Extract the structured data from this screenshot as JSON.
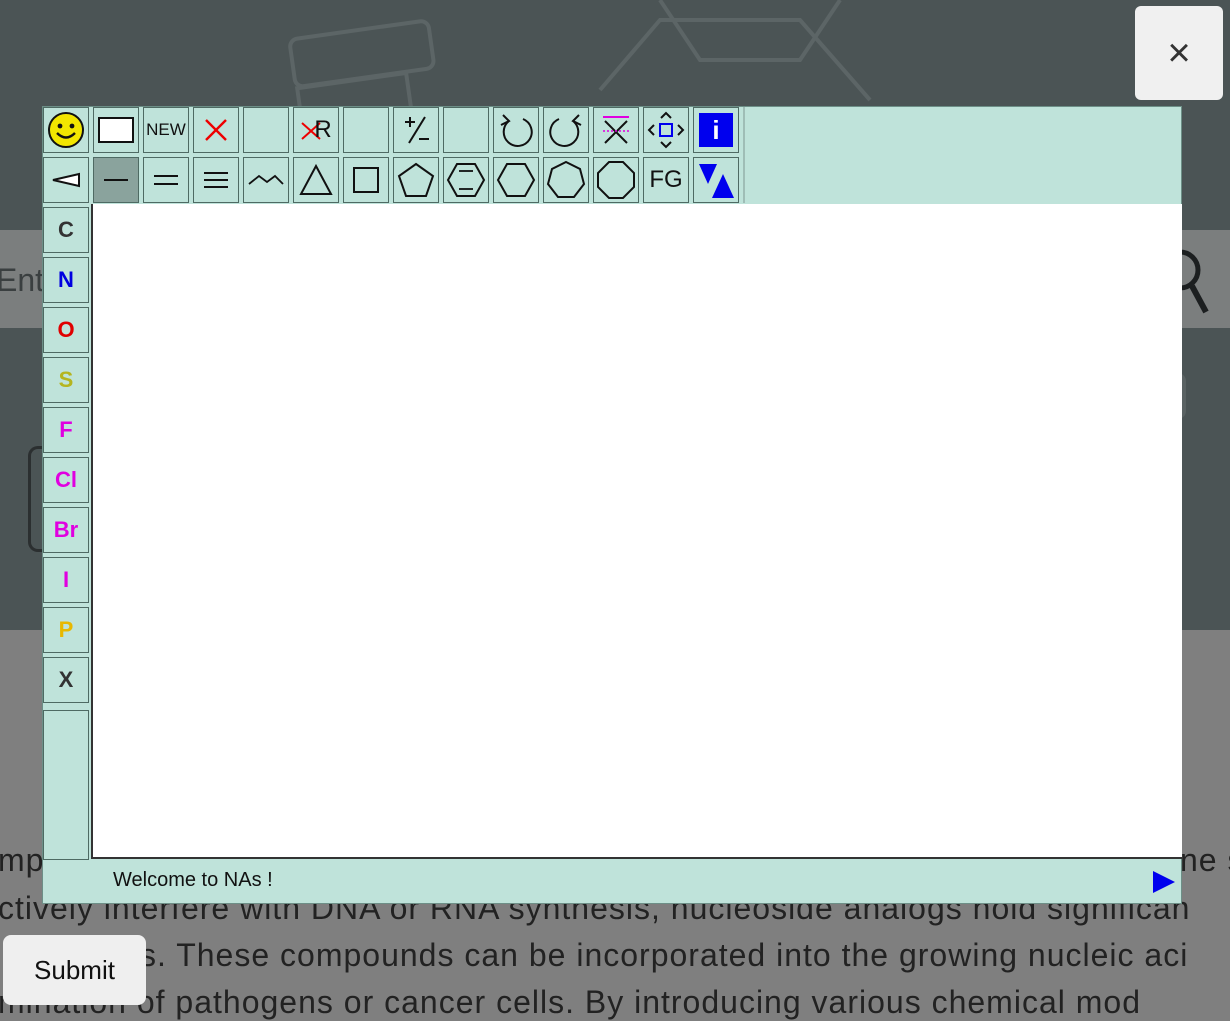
{
  "window": {
    "close_label": "×"
  },
  "background": {
    "search_placeholder": "Ente",
    "lines": [
      "mpo",
      "ne s",
      "ctively interfere with DNA or RNA synthesis, nucleoside analogs hold significan",
      "s. These compounds can be incorporated into the growing nucleic aci",
      "mination of pathogens or cancer cells. By introducing various chemical mod"
    ]
  },
  "editor": {
    "toolbar_top": [
      {
        "name": "smiley-icon"
      },
      {
        "name": "rectangle-select-icon"
      },
      {
        "name": "new-button",
        "label": "NEW"
      },
      {
        "name": "delete-icon"
      },
      {
        "name": "blank-tool-1"
      },
      {
        "name": "delete-r-group-icon",
        "label": "R"
      },
      {
        "name": "blank-tool-2"
      },
      {
        "name": "charge-icon"
      },
      {
        "name": "blank-tool-3"
      },
      {
        "name": "undo-icon"
      },
      {
        "name": "redo-icon"
      },
      {
        "name": "flip-icon"
      },
      {
        "name": "move-icon"
      },
      {
        "name": "info-icon",
        "label": "i"
      }
    ],
    "toolbar_second": [
      {
        "name": "wedge-bond-icon"
      },
      {
        "name": "single-bond-icon"
      },
      {
        "name": "double-bond-icon"
      },
      {
        "name": "triple-bond-icon"
      },
      {
        "name": "chain-icon"
      },
      {
        "name": "triangle-ring-icon"
      },
      {
        "name": "square-ring-icon"
      },
      {
        "name": "pentagon-ring-icon"
      },
      {
        "name": "benzene-ring-icon"
      },
      {
        "name": "hexagon-ring-icon"
      },
      {
        "name": "heptagon-ring-icon"
      },
      {
        "name": "octagon-ring-icon"
      },
      {
        "name": "fg-button",
        "label": "FG"
      },
      {
        "name": "template-icon"
      }
    ],
    "atoms": [
      {
        "symbol": "C",
        "color": "#333333"
      },
      {
        "symbol": "N",
        "color": "#0000e0"
      },
      {
        "symbol": "O",
        "color": "#e00000"
      },
      {
        "symbol": "S",
        "color": "#b5b51f"
      },
      {
        "symbol": "F",
        "color": "#e000e0"
      },
      {
        "symbol": "Cl",
        "color": "#e000e0"
      },
      {
        "symbol": "Br",
        "color": "#e000e0"
      },
      {
        "symbol": "I",
        "color": "#e000e0"
      },
      {
        "symbol": "P",
        "color": "#e8b800"
      },
      {
        "symbol": "X",
        "color": "#333333"
      }
    ],
    "status": "Welcome to NAs !"
  },
  "submit_label": "Submit",
  "colors": {
    "panel": "#bfe3da",
    "accent": "#0000ee"
  }
}
